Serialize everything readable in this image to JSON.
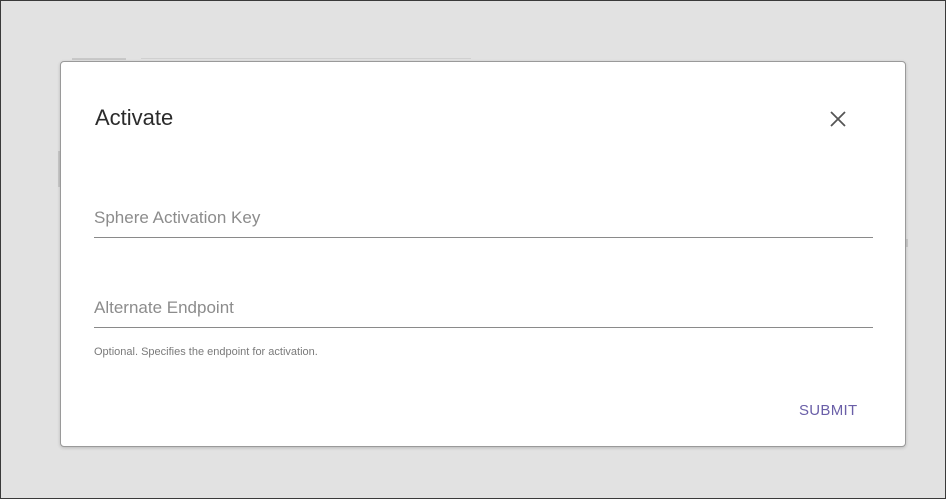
{
  "dialog": {
    "title": "Activate",
    "close_icon": "close-icon",
    "activation_key": {
      "placeholder": "Sphere Activation Key",
      "value": ""
    },
    "alternate_endpoint": {
      "placeholder": "Alternate Endpoint",
      "value": "",
      "helper": "Optional. Specifies the endpoint for activation."
    },
    "submit_label": "SUBMIT"
  },
  "colors": {
    "backdrop": "#e2e2e2",
    "accent": "#6a5fa8"
  }
}
